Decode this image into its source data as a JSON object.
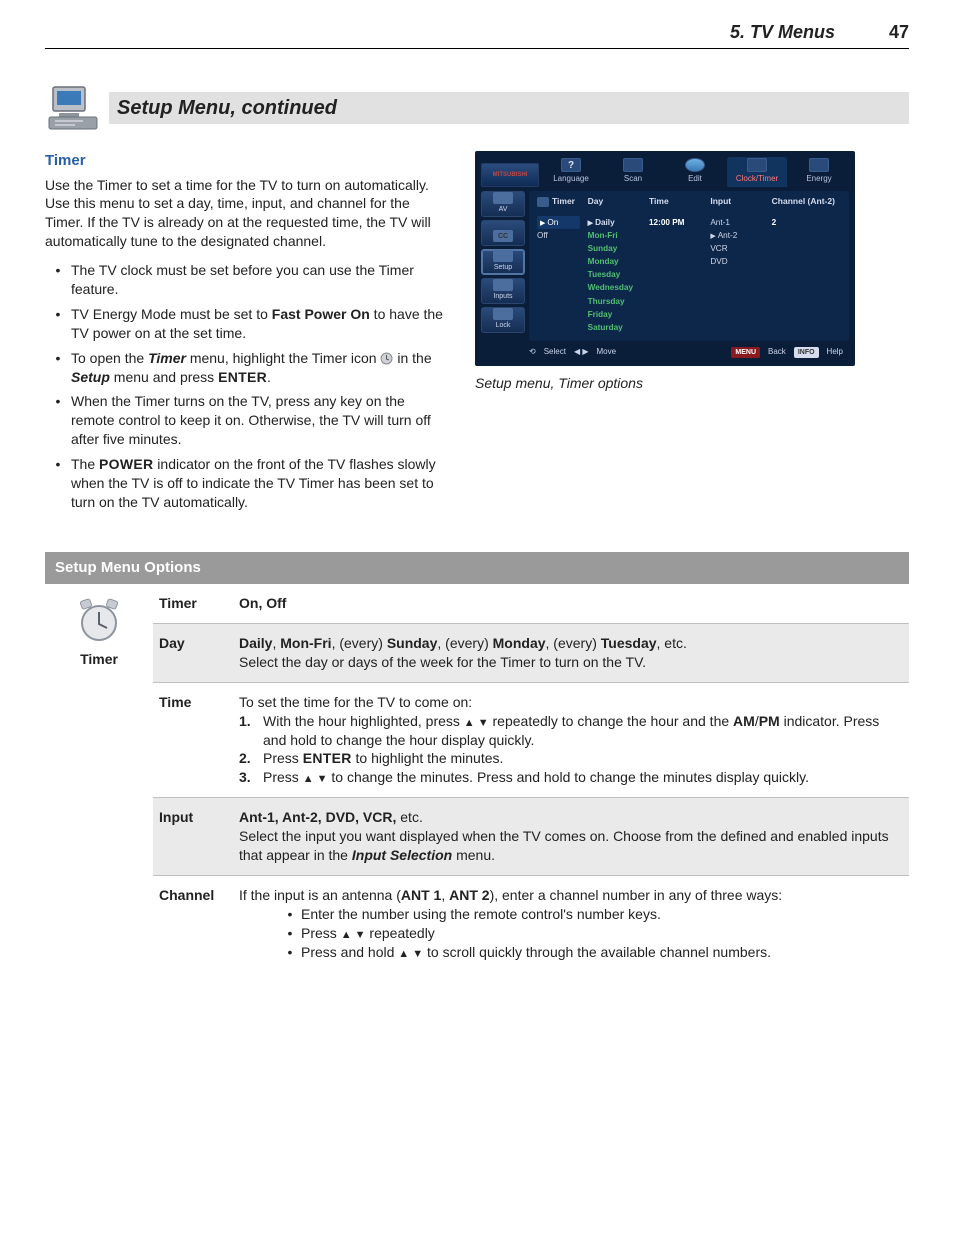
{
  "header": {
    "section": "5.  TV Menus",
    "page": "47"
  },
  "title": "Setup Menu, continued",
  "timer": {
    "heading": "Timer",
    "intro": "Use the Timer to set a time for the TV to turn on automatically.  Use this menu to set a day, time, input, and channel for the Timer.  If the TV is already on at the requested time, the TV will automatically tune to the designated channel.",
    "bullets": {
      "b1": "The TV clock must be set before you can use the Timer feature.",
      "b2a": "TV Energy Mode must be set to ",
      "b2b": "Fast Power On",
      "b2c": " to have the TV power on at the set time.",
      "b3a": "To open the ",
      "b3b": "Timer",
      "b3c": " menu, highlight the Timer icon ",
      "b3d": " in the ",
      "b3e": "Setup",
      "b3f": " menu and press ",
      "b3g": "ENTER",
      "b3h": ".",
      "b4": "When the Timer turns on the TV, press any key on the remote control to keep it on.  Otherwise, the TV will turn off after five minutes.",
      "b5a": "The ",
      "b5b": "POWER",
      "b5c": " indicator on the front of the TV flashes slowly when the TV is off to indicate the TV Timer has been set to turn on the TV automatically."
    }
  },
  "screenshot": {
    "logo": "MITSUBISHI",
    "tabs": {
      "t1": "Language",
      "t2": "Scan",
      "t3": "Edit",
      "t4": "Clock/Timer",
      "t5": "Energy"
    },
    "side": {
      "s1": "AV",
      "s2": "CC",
      "s3": "Setup",
      "s4": "Inputs",
      "s5": "Lock"
    },
    "cols": {
      "c1": "Timer",
      "c2": "Day",
      "c3": "Time",
      "c4": "Input",
      "c5": "Channel (Ant-2)"
    },
    "col1": {
      "on": "On",
      "off": "Off"
    },
    "col2": {
      "d1": "Daily",
      "d2": "Mon-Fri",
      "d3": "Sunday",
      "d4": "Monday",
      "d5": "Tuesday",
      "d6": "Wednesday",
      "d7": "Thursday",
      "d8": "Friday",
      "d9": "Saturday"
    },
    "col3": {
      "time": "12:00 PM"
    },
    "col4": {
      "i1": "Ant-1",
      "i2": "Ant-2",
      "i3": "VCR",
      "i4": "DVD"
    },
    "col5": {
      "ch": "2"
    },
    "footer": {
      "select": "Select",
      "move": "Move",
      "back": "Back",
      "help": "Help",
      "menu": "MENU",
      "info": "INFO"
    },
    "caption": "Setup menu, Timer options"
  },
  "options": {
    "header": "Setup Menu Options",
    "sideLabel": "Timer",
    "rows": {
      "timer": {
        "k": "Timer",
        "v": "On, Off"
      },
      "day": {
        "k": "Day",
        "l1a": "Daily",
        "l1b": ", ",
        "l1c": "Mon-Fri",
        "l1d": ", (every) ",
        "l1e": "Sunday",
        "l1f": ", (every) ",
        "l1g": "Monday",
        "l1h": ", (every) ",
        "l1i": "Tuesday",
        "l1j": ", etc.",
        "l2": "Select the day or days of the week for the Timer to turn on the TV."
      },
      "time": {
        "k": "Time",
        "intro": "To set the time for the TV to come on:",
        "s1a": "With the hour highlighted, press ",
        "s1b": "  repeatedly to change the hour and the ",
        "s1c": "AM",
        "s1d": "/",
        "s1e": "PM",
        "s1f": " indicator.  Press and hold to change the hour display quickly.",
        "s2a": "Press ",
        "s2b": "ENTER",
        "s2c": " to highlight the minutes.",
        "s3a": "Press ",
        "s3b": " to change the minutes.  Press and hold to change the minutes display quickly."
      },
      "input": {
        "k": "Input",
        "l1a": "Ant-1, Ant-2, DVD, VCR,",
        "l1b": " etc.",
        "l2a": "Select the input you want displayed when the TV comes on.  Choose from the defined and enabled inputs that appear in the ",
        "l2b": "Input Selection",
        "l2c": " menu."
      },
      "channel": {
        "k": "Channel",
        "introA": "If the input is an antenna (",
        "introB": "ANT 1",
        "introC": ", ",
        "introD": "ANT 2",
        "introE": "), enter a channel number in any of three ways:",
        "b1": "Enter the number using the remote control's number keys.",
        "b2a": "Press ",
        "b2b": " repeatedly",
        "b3a": "Press and hold  ",
        "b3b": " to scroll quickly through the available channel numbers."
      }
    }
  }
}
